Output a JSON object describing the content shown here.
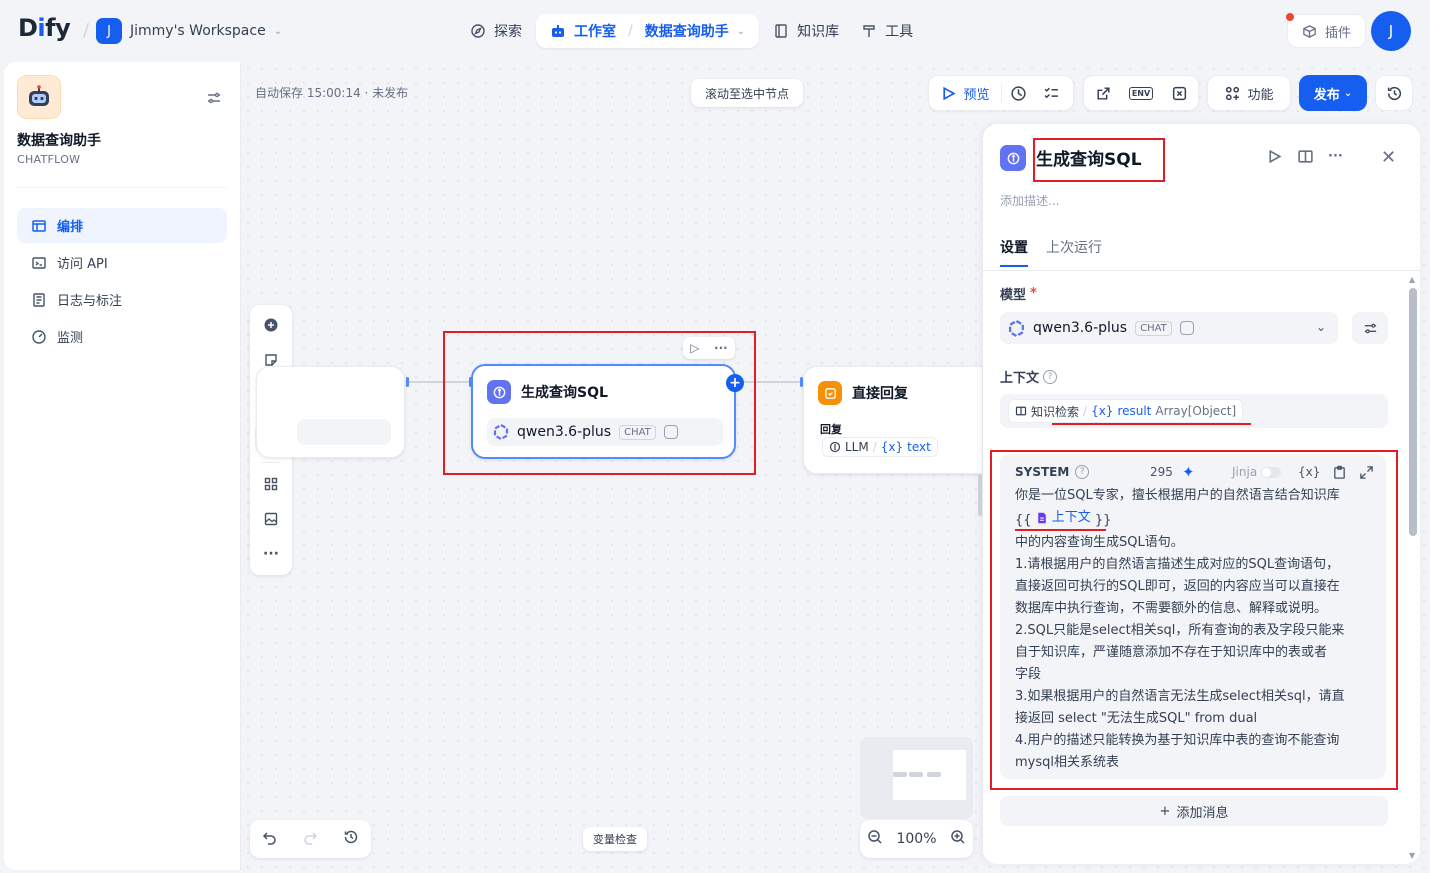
{
  "nav": {
    "logo": "Dify",
    "workspace_badge": "J",
    "workspace_name": "Jimmy's Workspace",
    "explore": "探索",
    "studio": "工作室",
    "current_app": "数据查询助手",
    "knowledge": "知识库",
    "tools": "工具",
    "plugins": "插件",
    "avatar": "J"
  },
  "sidebar": {
    "app_name": "数据查询助手",
    "app_type": "CHATFLOW",
    "items": [
      {
        "label": "编排",
        "icon": "layout-icon"
      },
      {
        "label": "访问 API",
        "icon": "terminal-icon"
      },
      {
        "label": "日志与标注",
        "icon": "file-list-icon"
      },
      {
        "label": "监测",
        "icon": "gauge-icon"
      }
    ]
  },
  "canvas": {
    "autosave": "自动保存 15:00:14 · 未发布",
    "scroll_to_selected": "滚动至选中节点",
    "preview": "预览",
    "features": "功能",
    "publish": "发布",
    "var_check": "变量检查",
    "zoom": "100%",
    "env_label": "ENV"
  },
  "nodes": {
    "llm": {
      "title": "生成查询SQL",
      "model": "qwen3.6-plus",
      "chip": "CHAT"
    },
    "answer": {
      "title": "直接回复",
      "label": "回复",
      "var_source": "LLM",
      "var_name": "text",
      "var_prefix": "{x}"
    }
  },
  "panel": {
    "title": "生成查询SQL",
    "desc_placeholder": "添加描述...",
    "tabs": [
      "设置",
      "上次运行"
    ],
    "model_label": "模型",
    "required_mark": "*",
    "model_name": "qwen3.6-plus",
    "model_chip": "CHAT",
    "context_label": "上下文",
    "context": {
      "source": "知识检索",
      "prefix": "{x}",
      "var": "result",
      "type": "Array[Object]"
    },
    "system": {
      "title": "SYSTEM",
      "count": "295",
      "jinja": "Jinja",
      "var_icon": "{x}",
      "line1": "你是一位SQL专家，擅长根据用户的自然语言结合知识库",
      "ref_open": "{{",
      "ref_name": "上下文",
      "ref_close": "}}",
      "lines": [
        "中的内容查询生成SQL语句。",
        "1.请根据用户的自然语言描述生成对应的SQL查询语句，",
        "直接返回可执行的SQL即可，返回的内容应当可以直接在",
        "数据库中执行查询，不需要额外的信息、解释或说明。",
        "2.SQL只能是select相关sql，所有查询的表及字段只能来",
        "自于知识库，严谨随意添加不存在于知识库中的表或者",
        "字段",
        "3.如果根据用户的自然语言无法生成select相关sql，请直",
        "接返回 select \"无法生成SQL\" from dual",
        "4.用户的描述只能转换为基于知识库中表的查询不能查询",
        "mysql相关系统表"
      ]
    },
    "add_message": "添加消息"
  },
  "colors": {
    "primary": "#155eef",
    "llm_icon": "#6172f3",
    "answer_icon": "#f79009",
    "annotation": "#e51c23"
  }
}
